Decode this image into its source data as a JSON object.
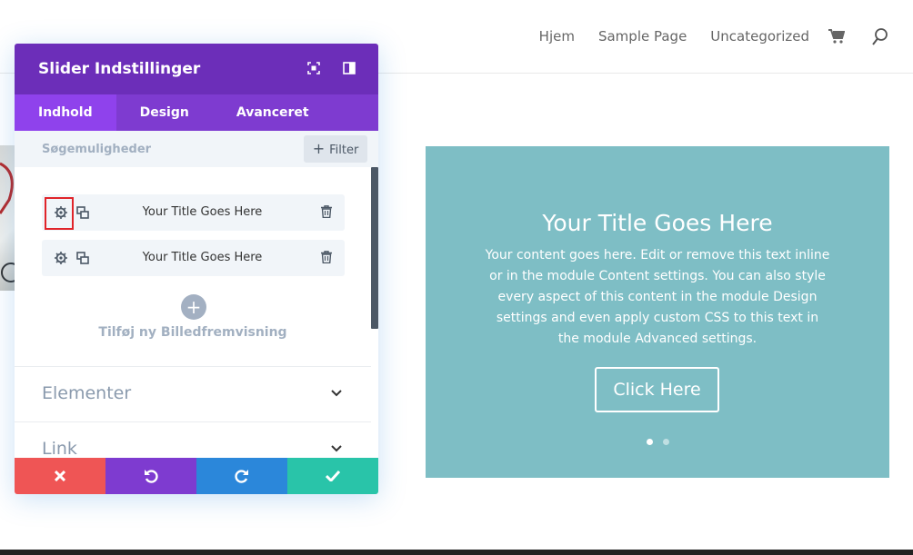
{
  "site": {
    "nav": [
      "Hjem",
      "Sample Page",
      "Uncategorized"
    ]
  },
  "slider": {
    "title": "Your Title Goes Here",
    "content": "Your content goes here. Edit or remove this text inline or in the module Content settings. You can also style every aspect of this content in the module Design settings and even apply custom CSS to this text in the module Advanced settings.",
    "button": "Click Here",
    "background": "#7ebec5",
    "dots_active": 1
  },
  "modal": {
    "title": "Slider Indstillinger",
    "tabs": [
      "Indhold",
      "Design",
      "Avanceret"
    ],
    "search_placeholder": "Søgemuligheder",
    "filter_label": "Filter",
    "slides": [
      "Your Title Goes Here",
      "Your Title Goes Here"
    ],
    "add_label": "Tilføj ny Billedfremvisning",
    "sections": [
      "Elementer",
      "Link"
    ],
    "colors": {
      "header": "#6c2eb9",
      "tabs": "#7e3bd0",
      "close": "#ef5555",
      "undo": "#7e3bd0",
      "redo": "#2b87da",
      "save": "#29c4a9"
    }
  }
}
